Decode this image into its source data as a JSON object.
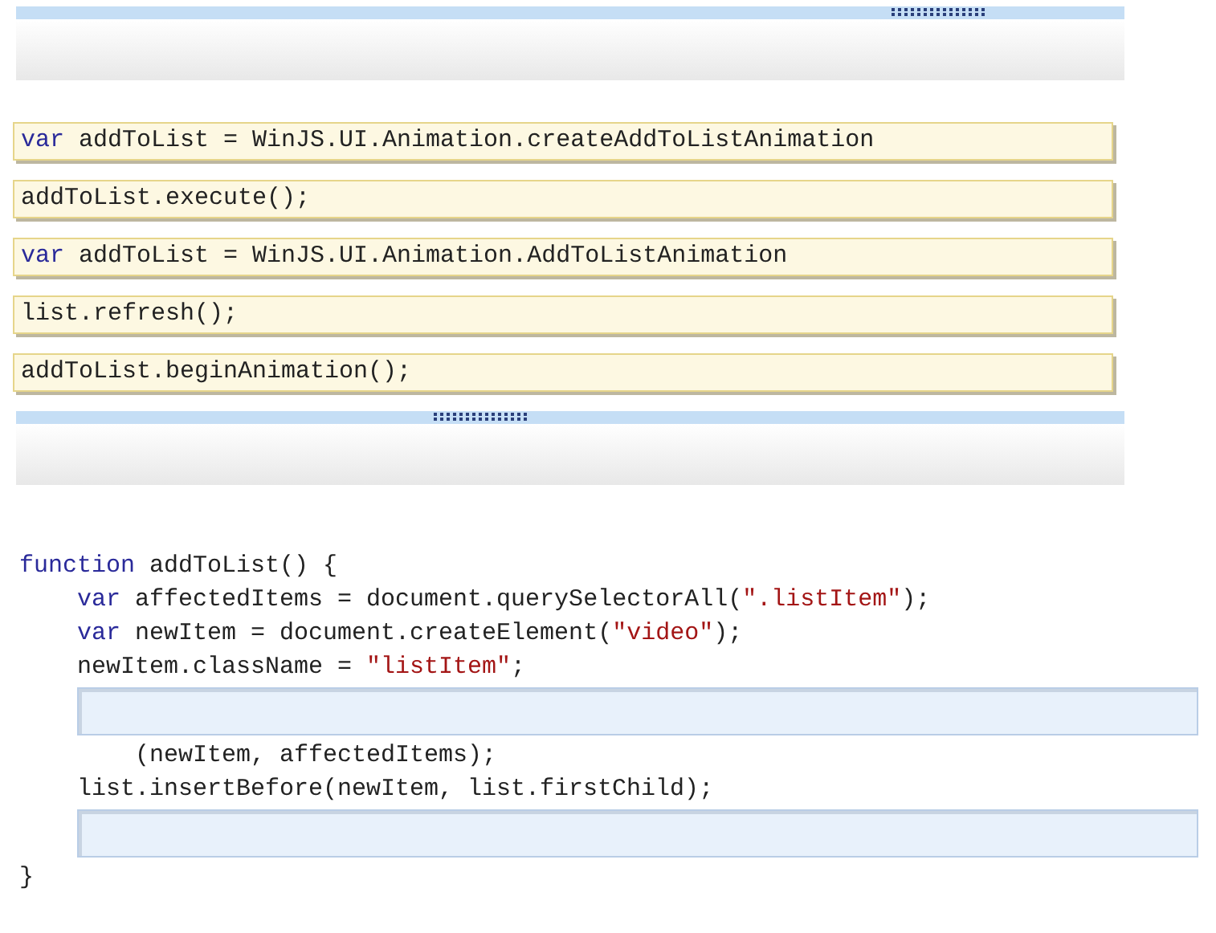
{
  "answer_area_top": {
    "kind": "drop-panel"
  },
  "snippets": [
    {
      "tokens": [
        {
          "kind": "keyword",
          "text": "var"
        },
        {
          "kind": "plain",
          "text": " addToList = WinJS.UI.Animation.createAddToListAnimation"
        }
      ]
    },
    {
      "tokens": [
        {
          "kind": "plain",
          "text": "addToList.execute();"
        }
      ]
    },
    {
      "tokens": [
        {
          "kind": "keyword",
          "text": "var"
        },
        {
          "kind": "plain",
          "text": " addToList = WinJS.UI.Animation.AddToListAnimation"
        }
      ]
    },
    {
      "tokens": [
        {
          "kind": "plain",
          "text": "list.refresh();"
        }
      ]
    },
    {
      "tokens": [
        {
          "kind": "plain",
          "text": "addToList.beginAnimation();"
        }
      ]
    }
  ],
  "code": [
    {
      "kind": "code",
      "tokens": [
        {
          "kind": "keyword",
          "text": "function"
        },
        {
          "kind": "plain",
          "text": " addToList() {"
        }
      ],
      "children": [
        {
          "kind": "code",
          "tokens": [
            {
              "kind": "keyword",
              "text": "var"
            },
            {
              "kind": "plain",
              "text": " affectedItems = document.querySelectorAll("
            },
            {
              "kind": "string",
              "text": "\".listItem\""
            },
            {
              "kind": "plain",
              "text": ");"
            }
          ]
        },
        {
          "kind": "code",
          "tokens": [
            {
              "kind": "keyword",
              "text": "var"
            },
            {
              "kind": "plain",
              "text": " newItem = document.createElement("
            },
            {
              "kind": "string",
              "text": "\"video\""
            },
            {
              "kind": "plain",
              "text": ");"
            }
          ]
        },
        {
          "kind": "code",
          "tokens": [
            {
              "kind": "plain",
              "text": "newItem.className = "
            },
            {
              "kind": "string",
              "text": "\"listItem\""
            },
            {
              "kind": "plain",
              "text": ";"
            }
          ]
        },
        {
          "kind": "drop",
          "children": [
            {
              "kind": "code",
              "tokens": [
                {
                  "kind": "plain",
                  "text": "(newItem, affectedItems);"
                }
              ]
            }
          ]
        },
        {
          "kind": "code",
          "tokens": [
            {
              "kind": "plain",
              "text": "list.insertBefore(newItem, list.firstChild);"
            }
          ]
        },
        {
          "kind": "drop"
        }
      ]
    },
    {
      "kind": "code",
      "tokens": [
        {
          "kind": "plain",
          "text": "}"
        }
      ]
    }
  ]
}
